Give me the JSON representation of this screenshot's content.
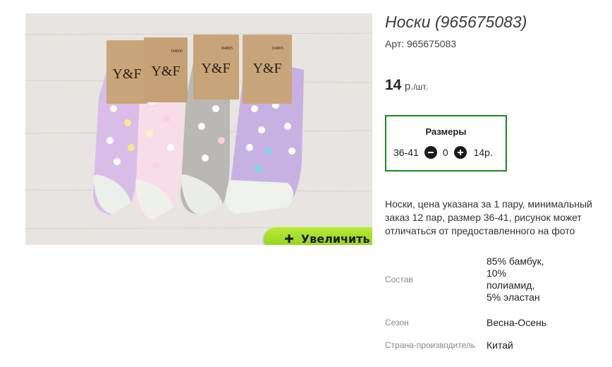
{
  "photo": {
    "tag_brand": "Y&F",
    "tag_code": "D4005",
    "zoom_button": {
      "icon": "plus-icon",
      "label": "Увеличить"
    }
  },
  "product": {
    "title": "Носки (965675083)",
    "article": "Арт: 965675083",
    "price": "14",
    "price_currency": "р.",
    "price_unit": "/шт."
  },
  "sizes": {
    "title": "Размеры",
    "row": {
      "size": "36-41",
      "minus_icon": "minus-icon",
      "quantity": "0",
      "plus_icon": "plus-icon",
      "price": "14р."
    }
  },
  "description": "Носки, цена указана за 1 пару, минимальный заказ 12 пар, размер 36-41, рисунок может отличаться от предоставленного на фото",
  "specs": [
    {
      "label": "Состав",
      "value": "85% бамбук, 10% полиамид, 5% эластан"
    },
    {
      "label": "Сезон",
      "value": "Весна-Осень"
    },
    {
      "label": "Страна-производитель",
      "value": "Китай"
    }
  ],
  "colors": {
    "accent_border": "#178a17",
    "zoom_button": "#9ddc22"
  }
}
